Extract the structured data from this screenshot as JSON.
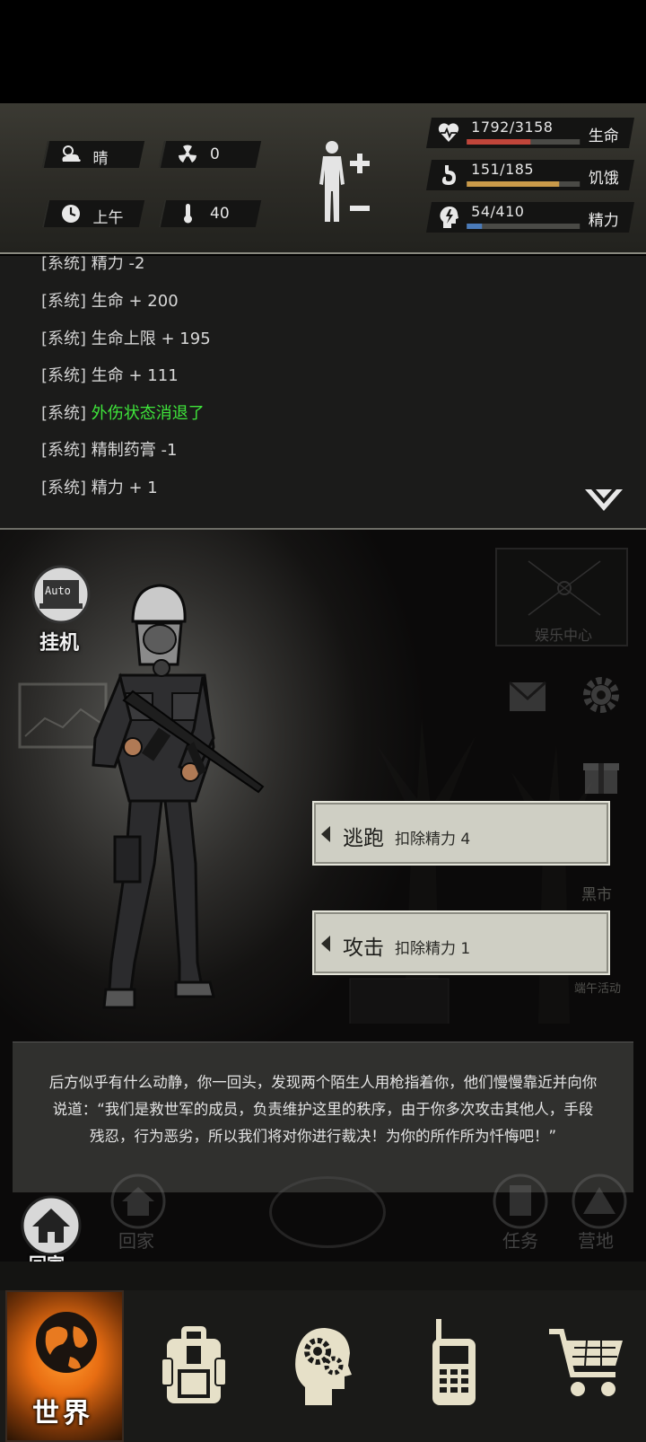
{
  "status": {
    "weather": "晴",
    "radiation": "0",
    "time_of_day": "上午",
    "temperature": "40",
    "bars": [
      {
        "value": "1792/3158",
        "label": "生命",
        "fill": 0.567,
        "color": "#c0453a"
      },
      {
        "value": "151/185",
        "label": "饥饿",
        "fill": 0.816,
        "color": "#c99a4a"
      },
      {
        "value": "54/410",
        "label": "精力",
        "fill": 0.132,
        "color": "#4a7ab8"
      }
    ]
  },
  "log": {
    "lines": [
      {
        "tag": "[系统]",
        "msg": "精力 -2"
      },
      {
        "tag": "[系统]",
        "msg": "生命 + 200"
      },
      {
        "tag": "[系统]",
        "msg": "生命上限 + 195"
      },
      {
        "tag": "[系统]",
        "msg": "生命 + 111"
      },
      {
        "tag": "[系统]",
        "msg": "外伤状态消退了",
        "highlight": true
      },
      {
        "tag": "[系统]",
        "msg": "精制药膏 -1"
      },
      {
        "tag": "[系统]",
        "msg": "精力 + 1"
      }
    ]
  },
  "scene": {
    "auto_label": "挂机",
    "auto_badge": "Auto",
    "entertainment_label": "娱乐中心",
    "black_market_label": "黑市",
    "event_label": "端午活动",
    "actions": [
      {
        "name": "逃跑",
        "cost": "扣除精力 4"
      },
      {
        "name": "攻击",
        "cost": "扣除精力 1"
      }
    ],
    "message": "后方似乎有什么动静，你一回头，发现两个陌生人用枪指着你，他们慢慢靠近并向你说道：“我们是救世军的成员，负责维护这里的秩序，由于你多次攻击其他人，手段残忍，行为恶劣，所以我们将对你进行裁决！为你的所作所为忏悔吧！”",
    "home_label": "回家",
    "ghost_home": "回家",
    "ghost_task": "任务",
    "ghost_camp": "营地"
  },
  "nav": {
    "world_label": "世界",
    "items": [
      "backpack-icon",
      "skills-head-icon",
      "radio-icon",
      "cart-icon"
    ]
  }
}
